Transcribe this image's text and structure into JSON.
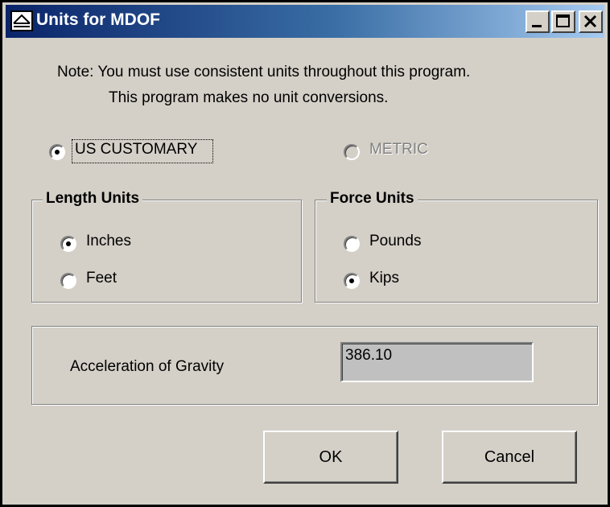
{
  "window": {
    "title": "Units for MDOF"
  },
  "note": {
    "line1": "Note: You must use consistent units throughout this program.",
    "line2": "This program makes no unit conversions."
  },
  "system": {
    "us_customary": {
      "label": "US CUSTOMARY",
      "selected": true,
      "enabled": true
    },
    "metric": {
      "label": "METRIC",
      "selected": false,
      "enabled": false
    }
  },
  "length_units": {
    "title": "Length Units",
    "options": [
      {
        "label": "Inches",
        "selected": true
      },
      {
        "label": "Feet",
        "selected": false
      }
    ]
  },
  "force_units": {
    "title": "Force Units",
    "options": [
      {
        "label": "Pounds",
        "selected": false
      },
      {
        "label": "Kips",
        "selected": true
      }
    ]
  },
  "gravity": {
    "label": "Acceleration of Gravity",
    "value": "386.10"
  },
  "buttons": {
    "ok": "OK",
    "cancel": "Cancel"
  },
  "colors": {
    "title_gradient_start": "#0a246a",
    "title_gradient_end": "#a6caf0",
    "dialog_face": "#d4d0c8"
  }
}
